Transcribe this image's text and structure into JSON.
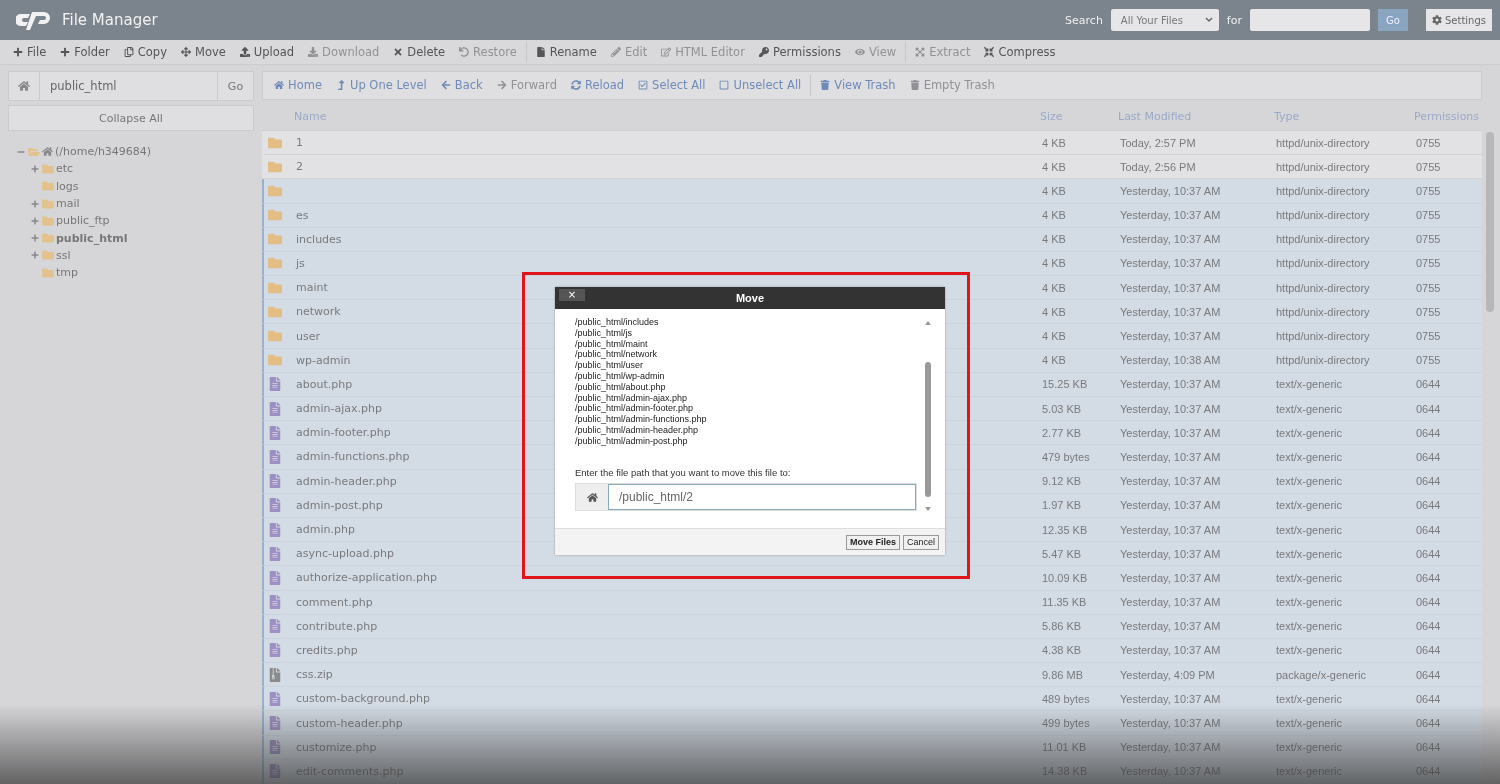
{
  "header": {
    "title": "File Manager",
    "search_label": "Search",
    "search_scope": "All Your Files",
    "for_label": "for",
    "go": "Go",
    "settings": "Settings"
  },
  "toolbar": [
    {
      "label": "File",
      "disabled": false
    },
    {
      "label": "Folder",
      "disabled": false
    },
    {
      "label": "Copy",
      "disabled": false
    },
    {
      "label": "Move",
      "disabled": false
    },
    {
      "label": "Upload",
      "disabled": false
    },
    {
      "label": "Download",
      "disabled": true
    },
    {
      "label": "Delete",
      "disabled": false
    },
    {
      "label": "Restore",
      "disabled": true
    },
    {
      "label": "Rename",
      "disabled": false
    },
    {
      "label": "Edit",
      "disabled": true
    },
    {
      "label": "HTML Editor",
      "disabled": true
    },
    {
      "label": "Permissions",
      "disabled": false
    },
    {
      "label": "View",
      "disabled": true
    },
    {
      "label": "Extract",
      "disabled": true
    },
    {
      "label": "Compress",
      "disabled": false
    }
  ],
  "path": {
    "value": "public_html",
    "go": "Go"
  },
  "collapse_all": "Collapse All",
  "tree": {
    "label": "(/home/h349684)",
    "expanded": true,
    "children": [
      {
        "label": "etc",
        "expandable": true,
        "selected": false
      },
      {
        "label": "logs",
        "expandable": false,
        "selected": false
      },
      {
        "label": "mail",
        "expandable": true,
        "selected": false
      },
      {
        "label": "public_ftp",
        "expandable": true,
        "selected": false
      },
      {
        "label": "public_html",
        "expandable": true,
        "selected": true
      },
      {
        "label": "ssl",
        "expandable": true,
        "selected": false
      },
      {
        "label": "tmp",
        "expandable": false,
        "selected": false
      }
    ]
  },
  "nav": [
    {
      "label": "Home",
      "disabled": false
    },
    {
      "label": "Up One Level",
      "disabled": false
    },
    {
      "label": "Back",
      "disabled": false
    },
    {
      "label": "Forward",
      "disabled": true
    },
    {
      "label": "Reload",
      "disabled": false
    },
    {
      "label": "Select All",
      "disabled": false
    },
    {
      "label": "Unselect All",
      "disabled": false
    },
    {
      "label": "View Trash",
      "disabled": false
    },
    {
      "label": "Empty Trash",
      "disabled": true
    }
  ],
  "table": {
    "columns": [
      "Name",
      "Size",
      "Last Modified",
      "Type",
      "Permissions"
    ],
    "rows": [
      {
        "kind": "folder",
        "name": "1",
        "size": "4 KB",
        "modified": "Today, 2:57 PM",
        "type": "httpd/unix-directory",
        "perms": "0755",
        "selected": false
      },
      {
        "kind": "folder",
        "name": "2",
        "size": "4 KB",
        "modified": "Today, 2:56 PM",
        "type": "httpd/unix-directory",
        "perms": "0755",
        "selected": false
      },
      {
        "kind": "folder",
        "size": "4 KB",
        "modified": "Yesterday, 10:37 AM",
        "type": "httpd/unix-directory",
        "perms": "0755",
        "selected": true
      },
      {
        "kind": "folder",
        "name": "es",
        "size": "4 KB",
        "modified": "Yesterday, 10:37 AM",
        "type": "httpd/unix-directory",
        "perms": "0755",
        "selected": true
      },
      {
        "kind": "folder",
        "name": "includes",
        "size": "4 KB",
        "modified": "Yesterday, 10:37 AM",
        "type": "httpd/unix-directory",
        "perms": "0755",
        "selected": true
      },
      {
        "kind": "folder",
        "name": "js",
        "size": "4 KB",
        "modified": "Yesterday, 10:37 AM",
        "type": "httpd/unix-directory",
        "perms": "0755",
        "selected": true
      },
      {
        "kind": "folder",
        "name": "maint",
        "size": "4 KB",
        "modified": "Yesterday, 10:37 AM",
        "type": "httpd/unix-directory",
        "perms": "0755",
        "selected": true
      },
      {
        "kind": "folder",
        "name": "network",
        "size": "4 KB",
        "modified": "Yesterday, 10:37 AM",
        "type": "httpd/unix-directory",
        "perms": "0755",
        "selected": true
      },
      {
        "kind": "folder",
        "name": "user",
        "size": "4 KB",
        "modified": "Yesterday, 10:37 AM",
        "type": "httpd/unix-directory",
        "perms": "0755",
        "selected": true
      },
      {
        "kind": "folder",
        "name": "wp-admin",
        "size": "4 KB",
        "modified": "Yesterday, 10:38 AM",
        "type": "httpd/unix-directory",
        "perms": "0755",
        "selected": true
      },
      {
        "kind": "text",
        "name": "about.php",
        "size": "15.25 KB",
        "modified": "Yesterday, 10:37 AM",
        "type": "text/x-generic",
        "perms": "0644",
        "selected": true
      },
      {
        "kind": "text",
        "name": "admin-ajax.php",
        "size": "5.03 KB",
        "modified": "Yesterday, 10:37 AM",
        "type": "text/x-generic",
        "perms": "0644",
        "selected": true
      },
      {
        "kind": "text",
        "name": "admin-footer.php",
        "size": "2.77 KB",
        "modified": "Yesterday, 10:37 AM",
        "type": "text/x-generic",
        "perms": "0644",
        "selected": true
      },
      {
        "kind": "text",
        "name": "admin-functions.php",
        "size": "479 bytes",
        "modified": "Yesterday, 10:37 AM",
        "type": "text/x-generic",
        "perms": "0644",
        "selected": true
      },
      {
        "kind": "text",
        "name": "admin-header.php",
        "size": "9.12 KB",
        "modified": "Yesterday, 10:37 AM",
        "type": "text/x-generic",
        "perms": "0644",
        "selected": true
      },
      {
        "kind": "text",
        "name": "admin-post.php",
        "size": "1.97 KB",
        "modified": "Yesterday, 10:37 AM",
        "type": "text/x-generic",
        "perms": "0644",
        "selected": true
      },
      {
        "kind": "text",
        "name": "admin.php",
        "size": "12.35 KB",
        "modified": "Yesterday, 10:37 AM",
        "type": "text/x-generic",
        "perms": "0644",
        "selected": true
      },
      {
        "kind": "text",
        "name": "async-upload.php",
        "size": "5.47 KB",
        "modified": "Yesterday, 10:37 AM",
        "type": "text/x-generic",
        "perms": "0644",
        "selected": true
      },
      {
        "kind": "text",
        "name": "authorize-application.php",
        "size": "10.09 KB",
        "modified": "Yesterday, 10:37 AM",
        "type": "text/x-generic",
        "perms": "0644",
        "selected": true
      },
      {
        "kind": "text",
        "name": "comment.php",
        "size": "11.35 KB",
        "modified": "Yesterday, 10:37 AM",
        "type": "text/x-generic",
        "perms": "0644",
        "selected": true
      },
      {
        "kind": "text",
        "name": "contribute.php",
        "size": "5.86 KB",
        "modified": "Yesterday, 10:37 AM",
        "type": "text/x-generic",
        "perms": "0644",
        "selected": true
      },
      {
        "kind": "text",
        "name": "credits.php",
        "size": "4.38 KB",
        "modified": "Yesterday, 10:37 AM",
        "type": "text/x-generic",
        "perms": "0644",
        "selected": true
      },
      {
        "kind": "archive",
        "name": "css.zip",
        "size": "9.86 MB",
        "modified": "Yesterday, 4:09 PM",
        "type": "package/x-generic",
        "perms": "0644",
        "selected": true
      },
      {
        "kind": "text",
        "name": "custom-background.php",
        "size": "489 bytes",
        "modified": "Yesterday, 10:37 AM",
        "type": "text/x-generic",
        "perms": "0644",
        "selected": true
      },
      {
        "kind": "text",
        "name": "custom-header.php",
        "size": "499 bytes",
        "modified": "Yesterday, 10:37 AM",
        "type": "text/x-generic",
        "perms": "0644",
        "selected": true
      },
      {
        "kind": "text",
        "name": "customize.php",
        "size": "11.01 KB",
        "modified": "Yesterday, 10:37 AM",
        "type": "text/x-generic",
        "perms": "0644",
        "selected": true
      },
      {
        "kind": "text",
        "name": "edit-comments.php",
        "size": "14.38 KB",
        "modified": "Yesterday, 10:37 AM",
        "type": "text/x-generic",
        "perms": "0644",
        "selected": true
      }
    ]
  },
  "dialog": {
    "title": "Move",
    "close": "×",
    "paths": [
      "/public_html/includes",
      "/public_html/js",
      "/public_html/maint",
      "/public_html/network",
      "/public_html/user",
      "/public_html/wp-admin",
      "/public_html/about.php",
      "/public_html/admin-ajax.php",
      "/public_html/admin-footer.php",
      "/public_html/admin-functions.php",
      "/public_html/admin-header.php",
      "/public_html/admin-post.php"
    ],
    "prompt": "Enter the file path that you want to move this file to:",
    "destination": "/public_html/2",
    "buttons": [
      "Move Files",
      "Cancel"
    ]
  }
}
